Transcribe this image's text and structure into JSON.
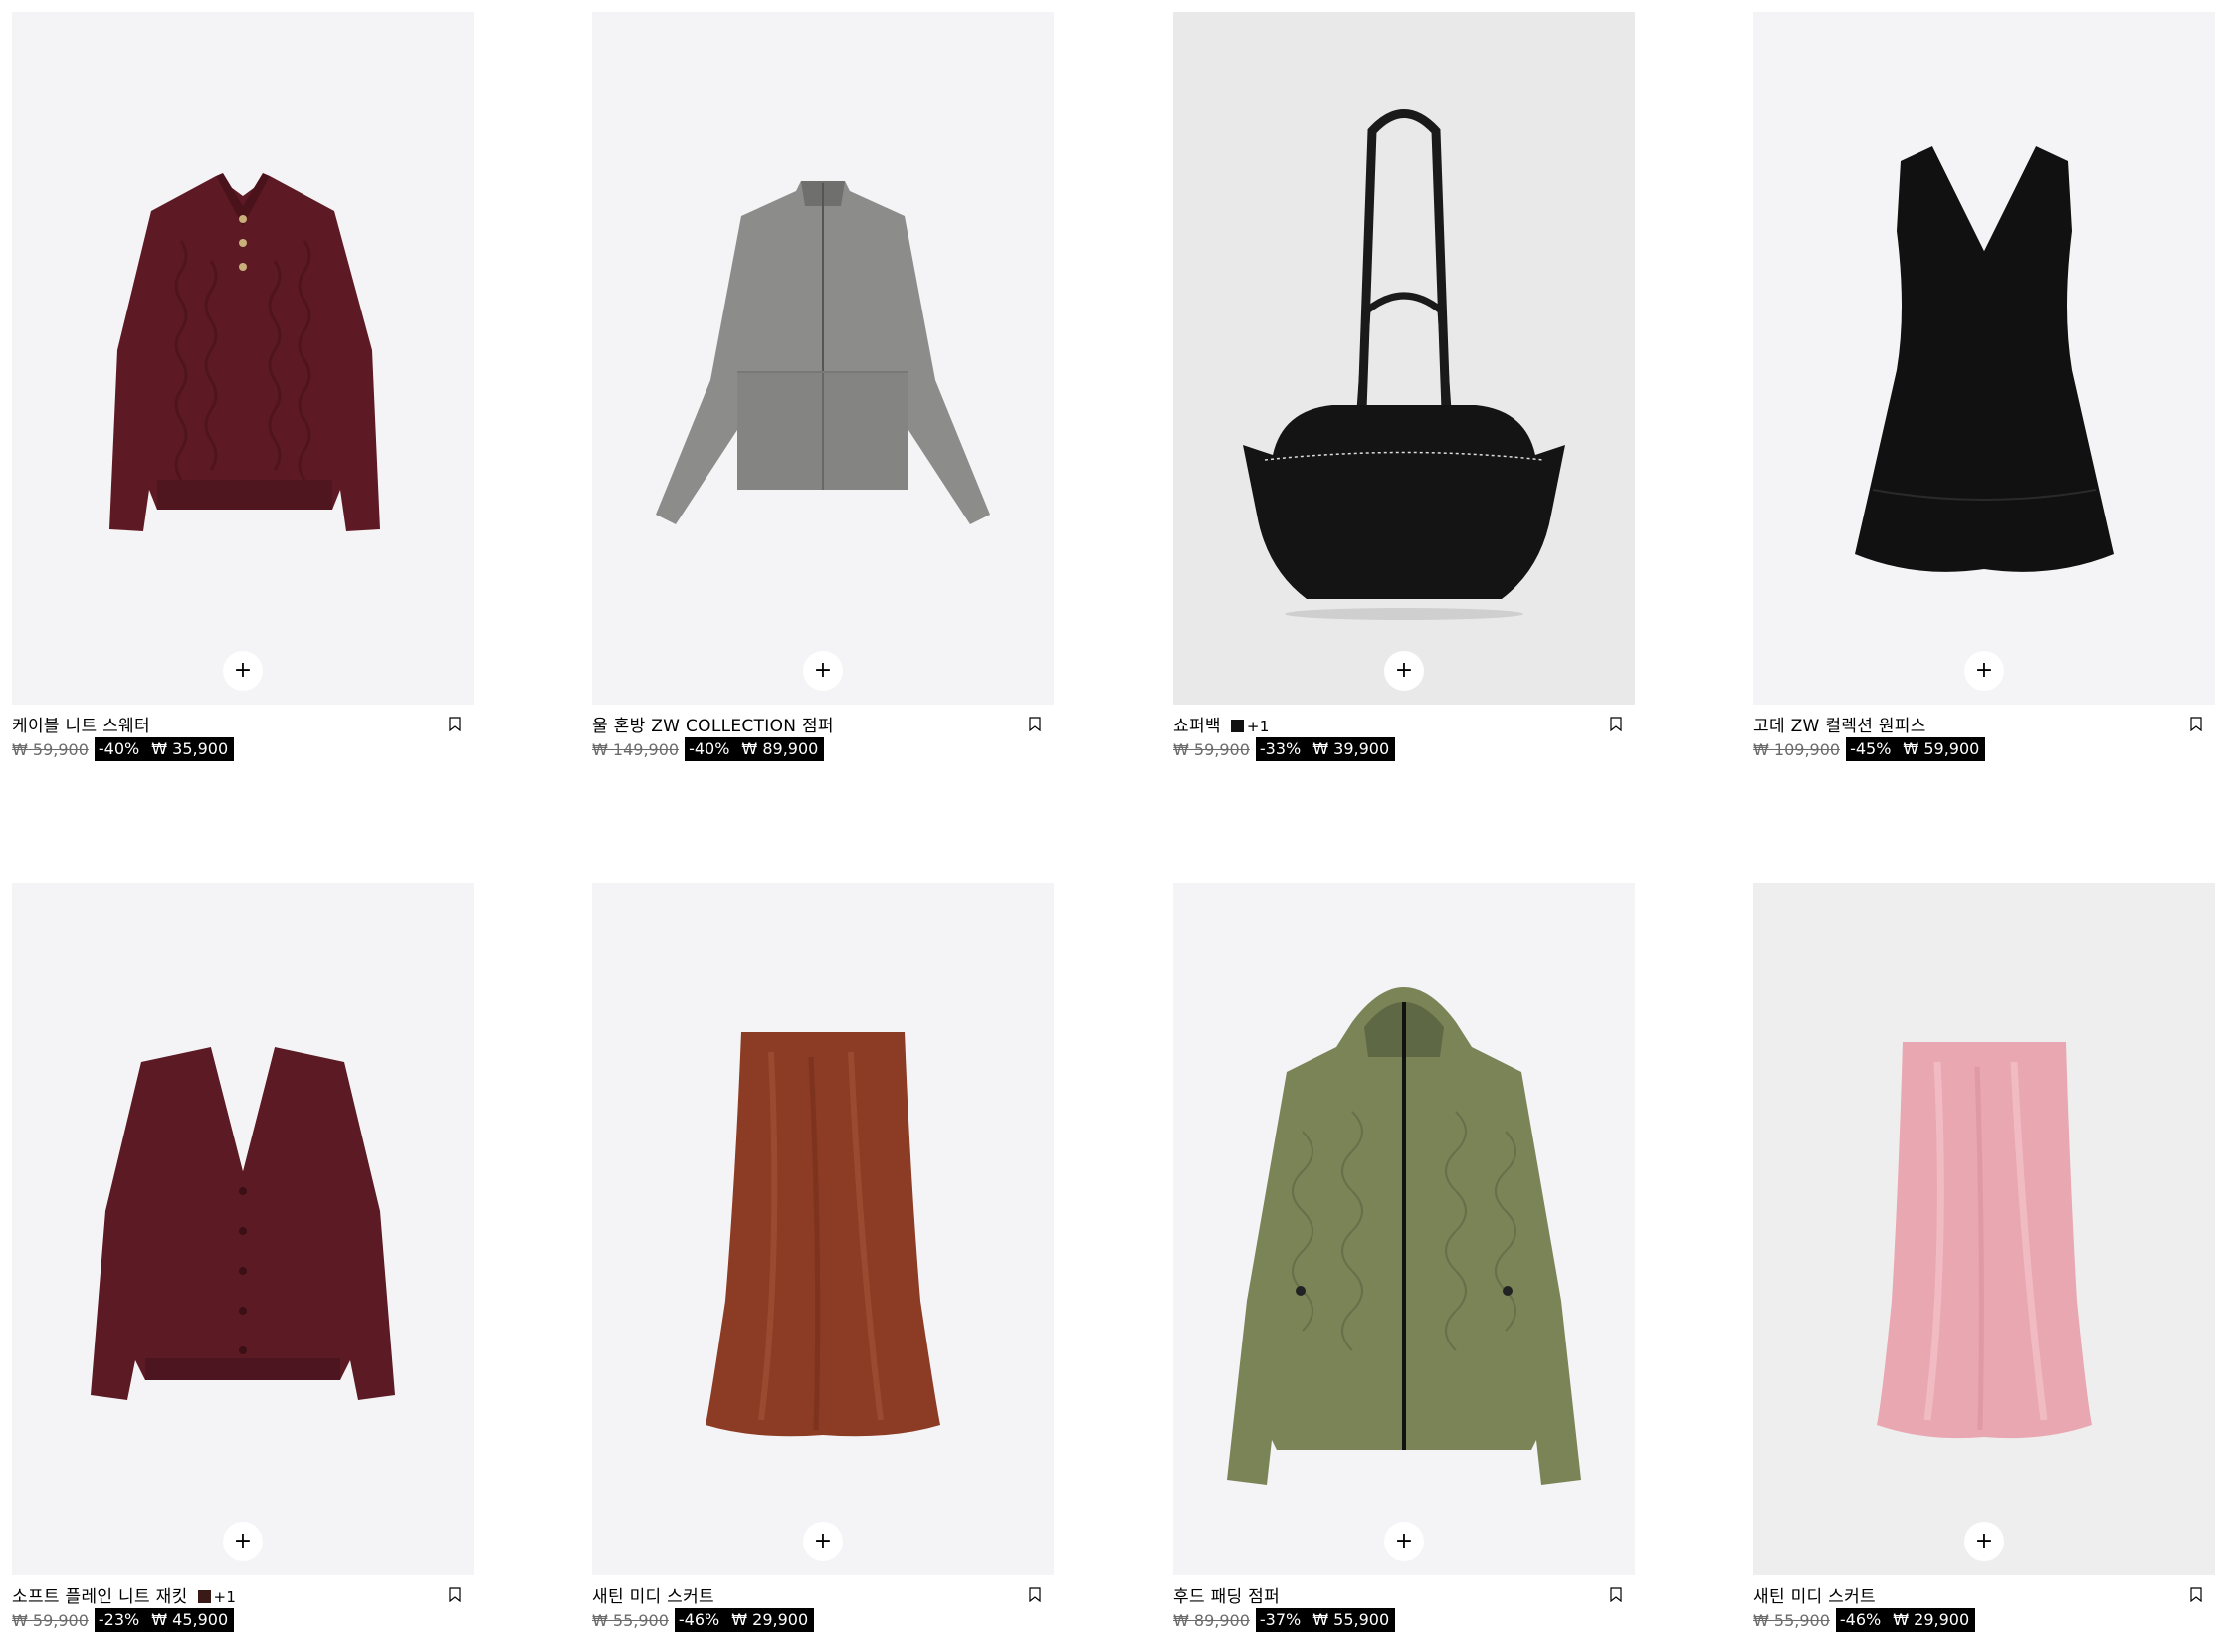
{
  "products": [
    {
      "name": "케이블 니트 스웨터",
      "old_price": "₩ 59,900",
      "discount": "-40%",
      "price": "₩ 35,900",
      "swatch": null,
      "more_colors": null,
      "image": "burgundy-cable-knit-sweater"
    },
    {
      "name": "울 혼방 ZW COLLECTION 점퍼",
      "old_price": "₩ 149,900",
      "discount": "-40%",
      "price": "₩ 89,900",
      "swatch": null,
      "more_colors": null,
      "image": "grey-wool-zip-jacket"
    },
    {
      "name": "쇼퍼백",
      "old_price": "₩ 59,900",
      "discount": "-33%",
      "price": "₩ 39,900",
      "swatch": "#111111",
      "more_colors": "+1",
      "image": "black-shopper-bag"
    },
    {
      "name": "고데 ZW 컬렉션 원피스",
      "old_price": "₩ 109,900",
      "discount": "-45%",
      "price": "₩ 59,900",
      "swatch": null,
      "more_colors": null,
      "image": "black-sleeveless-dress"
    },
    {
      "name": "소프트 플레인 니트 재킷",
      "old_price": "₩ 59,900",
      "discount": "-23%",
      "price": "₩ 45,900",
      "swatch": "#3a1a16",
      "more_colors": "+1",
      "image": "burgundy-knit-cardigan"
    },
    {
      "name": "새틴 미디 스커트",
      "old_price": "₩ 55,900",
      "discount": "-46%",
      "price": "₩ 29,900",
      "swatch": null,
      "more_colors": null,
      "image": "rust-satin-skirt"
    },
    {
      "name": "후드 패딩 점퍼",
      "old_price": "₩ 89,900",
      "discount": "-37%",
      "price": "₩ 55,900",
      "swatch": null,
      "more_colors": null,
      "image": "khaki-quilted-hooded-jacket"
    },
    {
      "name": "새틴 미디 스커트",
      "old_price": "₩ 55,900",
      "discount": "-46%",
      "price": "₩ 29,900",
      "swatch": null,
      "more_colors": null,
      "image": "pink-satin-skirt"
    }
  ],
  "icons": {
    "add": "plus-icon",
    "save": "bookmark-icon"
  },
  "add_label": "+",
  "colors": {
    "image_bg": "#f4f3f5",
    "sale_bg": "#000000",
    "sale_text": "#ffffff",
    "old_price": "#6b6b6b"
  }
}
